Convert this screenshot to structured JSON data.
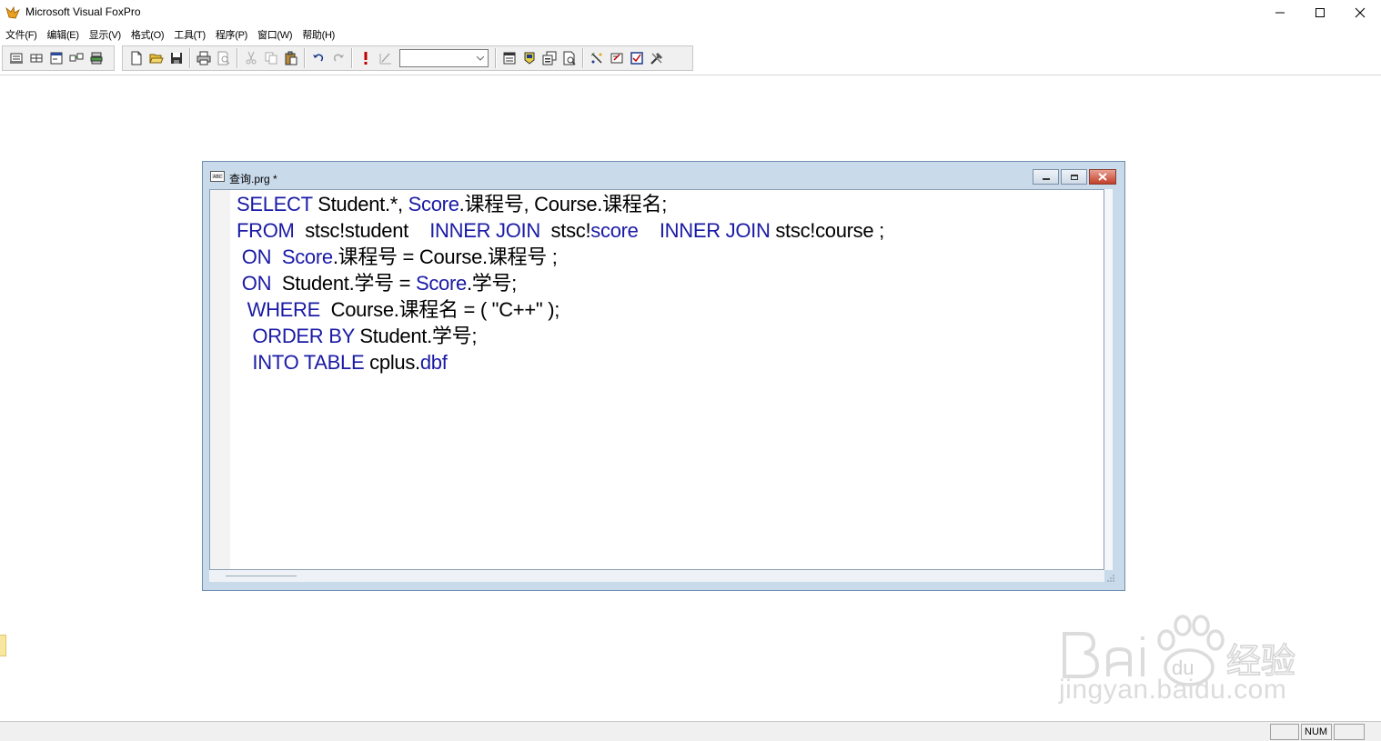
{
  "window": {
    "title": "Microsoft Visual FoxPro",
    "controls": [
      "minimize",
      "maximize",
      "close"
    ]
  },
  "menubar": {
    "items": [
      "文件(F)",
      "编辑(E)",
      "显示(V)",
      "格式(O)",
      "工具(T)",
      "程序(P)",
      "窗口(W)",
      "帮助(H)"
    ]
  },
  "toolbar": {
    "combo_value": "",
    "icons": [
      "report-icon",
      "label-icon",
      "form-icon",
      "database-icon",
      "project-icon",
      "new-icon",
      "open-icon",
      "save-icon",
      "print-icon",
      "print-preview-icon",
      "cut-icon",
      "copy-icon",
      "paste-icon",
      "undo-icon",
      "redo-icon",
      "run-icon",
      "modify-form-icon",
      "combo-box",
      "command-window-icon",
      "data-session-icon",
      "properties-icon",
      "code-icon",
      "form-wizard-icon",
      "report-wizard-icon",
      "toolbox-icon",
      "builder-icon"
    ]
  },
  "editor": {
    "title": "查询.prg *",
    "lines": [
      [
        {
          "t": "SELECT",
          "k": true
        },
        {
          "t": " Student.*, ",
          "k": false
        },
        {
          "t": "Score",
          "k": true
        },
        {
          "t": ".课程号, Course.课程名;",
          "k": false
        }
      ],
      [
        {
          "t": "FROM",
          "k": true
        },
        {
          "t": "  stsc!student    ",
          "k": false
        },
        {
          "t": "INNER JOIN",
          "k": true
        },
        {
          "t": "  stsc!",
          "k": false
        },
        {
          "t": "score",
          "k": true
        },
        {
          "t": "    ",
          "k": false
        },
        {
          "t": "INNER JOIN",
          "k": true
        },
        {
          "t": " stsc!course ;",
          "k": false
        }
      ],
      [
        {
          "t": " ON",
          "k": true
        },
        {
          "t": "  ",
          "k": false
        },
        {
          "t": "Score",
          "k": true
        },
        {
          "t": ".课程号 = Course.课程号 ;",
          "k": false
        }
      ],
      [
        {
          "t": " ON",
          "k": true
        },
        {
          "t": "  Student.学号 = ",
          "k": false
        },
        {
          "t": "Score",
          "k": true
        },
        {
          "t": ".学号;",
          "k": false
        }
      ],
      [
        {
          "t": "  WHERE",
          "k": true
        },
        {
          "t": "  Course.课程名 = ( \"C++\" );",
          "k": false
        }
      ],
      [
        {
          "t": "   ORDER BY",
          "k": true
        },
        {
          "t": " Student.学号;",
          "k": false
        }
      ],
      [
        {
          "t": "   INTO TABLE",
          "k": true
        },
        {
          "t": " cplus.",
          "k": false
        },
        {
          "t": "dbf",
          "k": true
        }
      ]
    ]
  },
  "statusbar": {
    "num_indicator": "NUM"
  },
  "watermark": {
    "brand": "Bai du 经验",
    "url": "jingyan.baidu.com"
  },
  "colors": {
    "keyword": "#1a1aa6",
    "editor_frame": "#c9daea",
    "close_button": "#c2402a"
  }
}
